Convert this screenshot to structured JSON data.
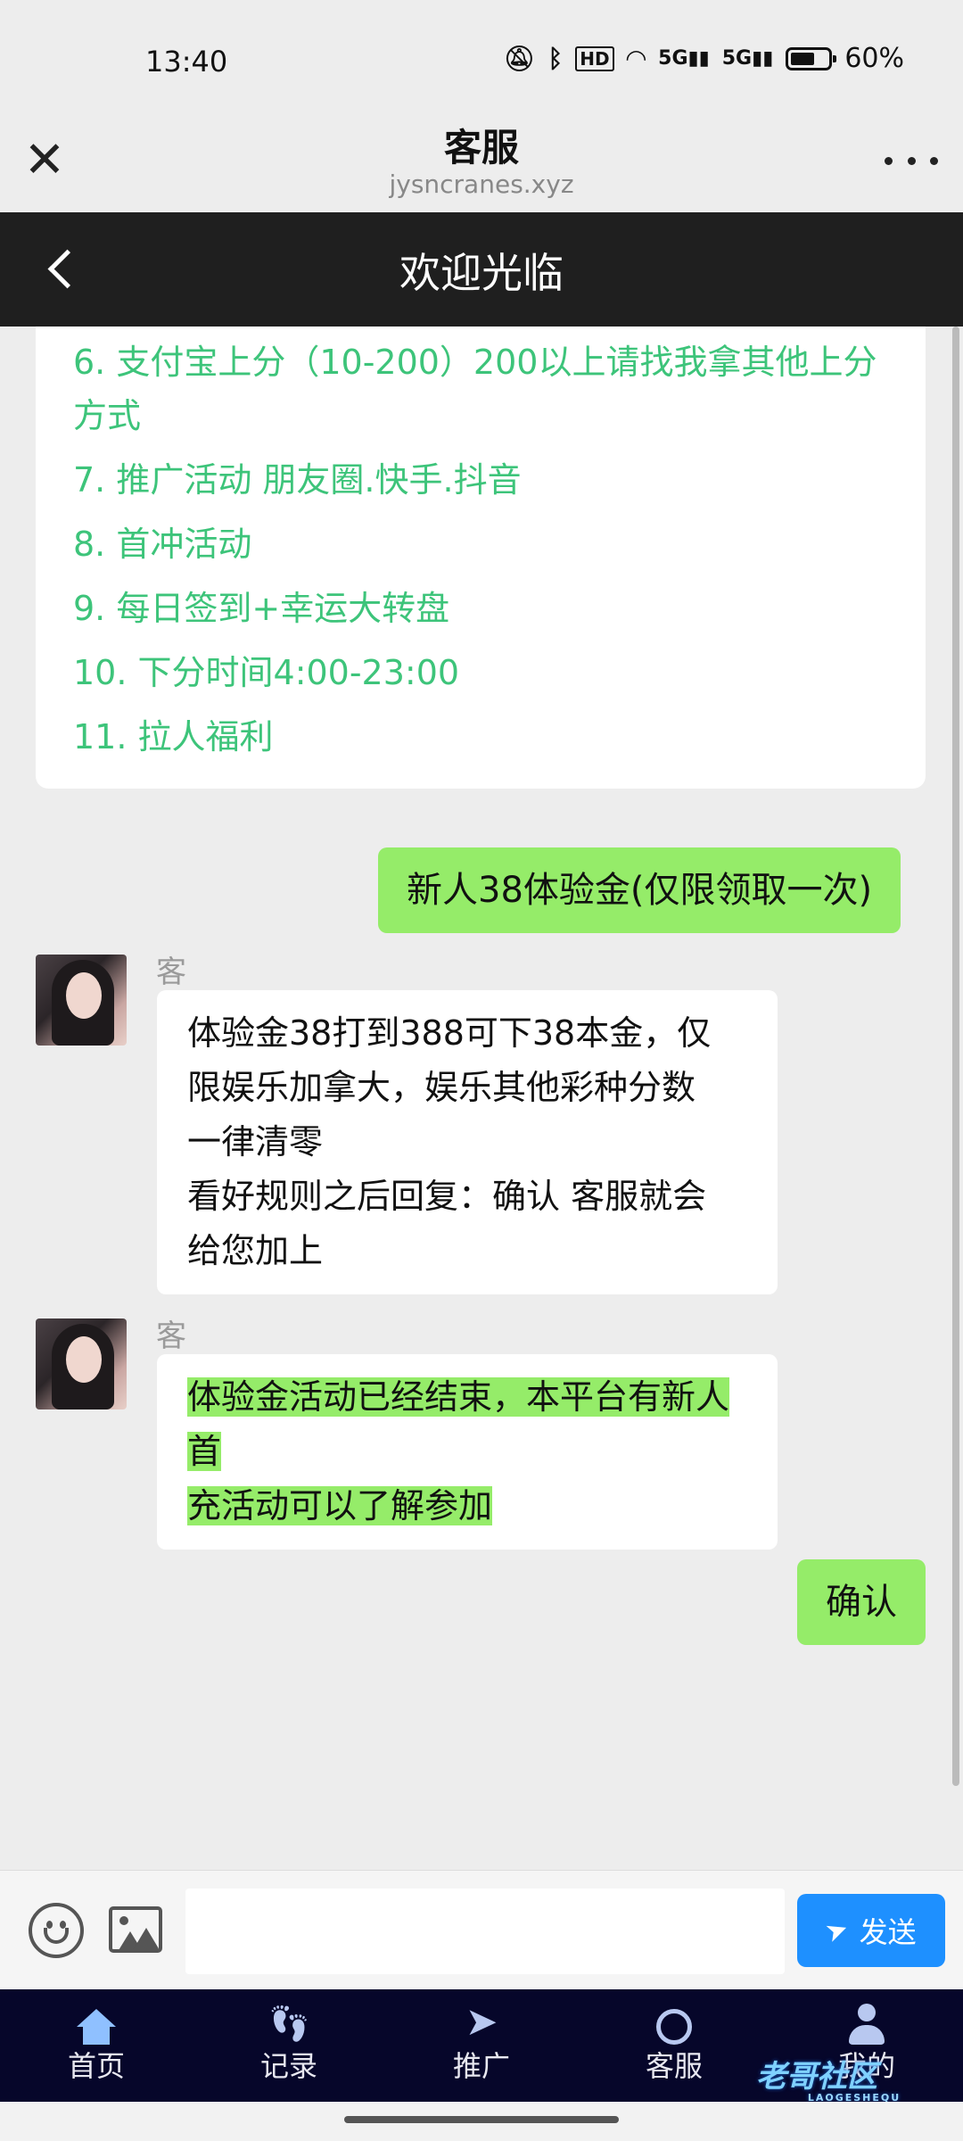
{
  "status_bar": {
    "time": "13:40",
    "icons": [
      "bell-off-icon",
      "bluetooth-icon",
      "hd-icon",
      "wifi-icon",
      "5g-signal-icon",
      "5g-signal-icon",
      "battery-icon"
    ],
    "battery": "60%"
  },
  "titlebar": {
    "title": "客服",
    "subtitle": "jysncranes.xyz"
  },
  "page_header": {
    "title": "欢迎光临"
  },
  "menu": {
    "items": [
      "6. 支付宝上分（10-200）200以上请找我拿其他上分方式",
      "7. 推广活动 朋友圈.快手.抖音",
      "8. 首冲活动",
      "9. 每日签到+幸运大转盘",
      "10. 下分时间4:00-23:00",
      "11. 拉人福利"
    ]
  },
  "messages": {
    "user_1": "新人38体验金(仅限领取一次)",
    "agent_1": {
      "sender": "客服小新",
      "lines": [
        "体验金38打到388可下38本金，仅",
        "限娱乐加拿大，娱乐其他彩种分数",
        "一律清零",
        "看好规则之后回复：确认 客服就会",
        "给您加上"
      ]
    },
    "agent_2": {
      "sender": "客服小新",
      "lines": [
        "体验金活动已经结束，本平台有新人首",
        "充活动可以了解参加"
      ]
    },
    "user_2": "确认"
  },
  "input": {
    "placeholder": "",
    "send_label": "发送"
  },
  "nav": {
    "items": [
      {
        "label": "首页",
        "icon": "home-icon"
      },
      {
        "label": "记录",
        "icon": "footprint-icon"
      },
      {
        "label": "推广",
        "icon": "paper-plane-icon"
      },
      {
        "label": "客服",
        "icon": "headset-icon"
      },
      {
        "label": "我的",
        "icon": "user-icon"
      }
    ]
  },
  "watermark": {
    "text": "老哥社区",
    "sub": "LAOGESHEQU"
  },
  "colors": {
    "menu_text": "#3dc47a",
    "user_bubble": "#95ec69",
    "send_button": "#1e90ff",
    "header_bg": "#1f1f1f",
    "nav_bg": "#06062a"
  }
}
